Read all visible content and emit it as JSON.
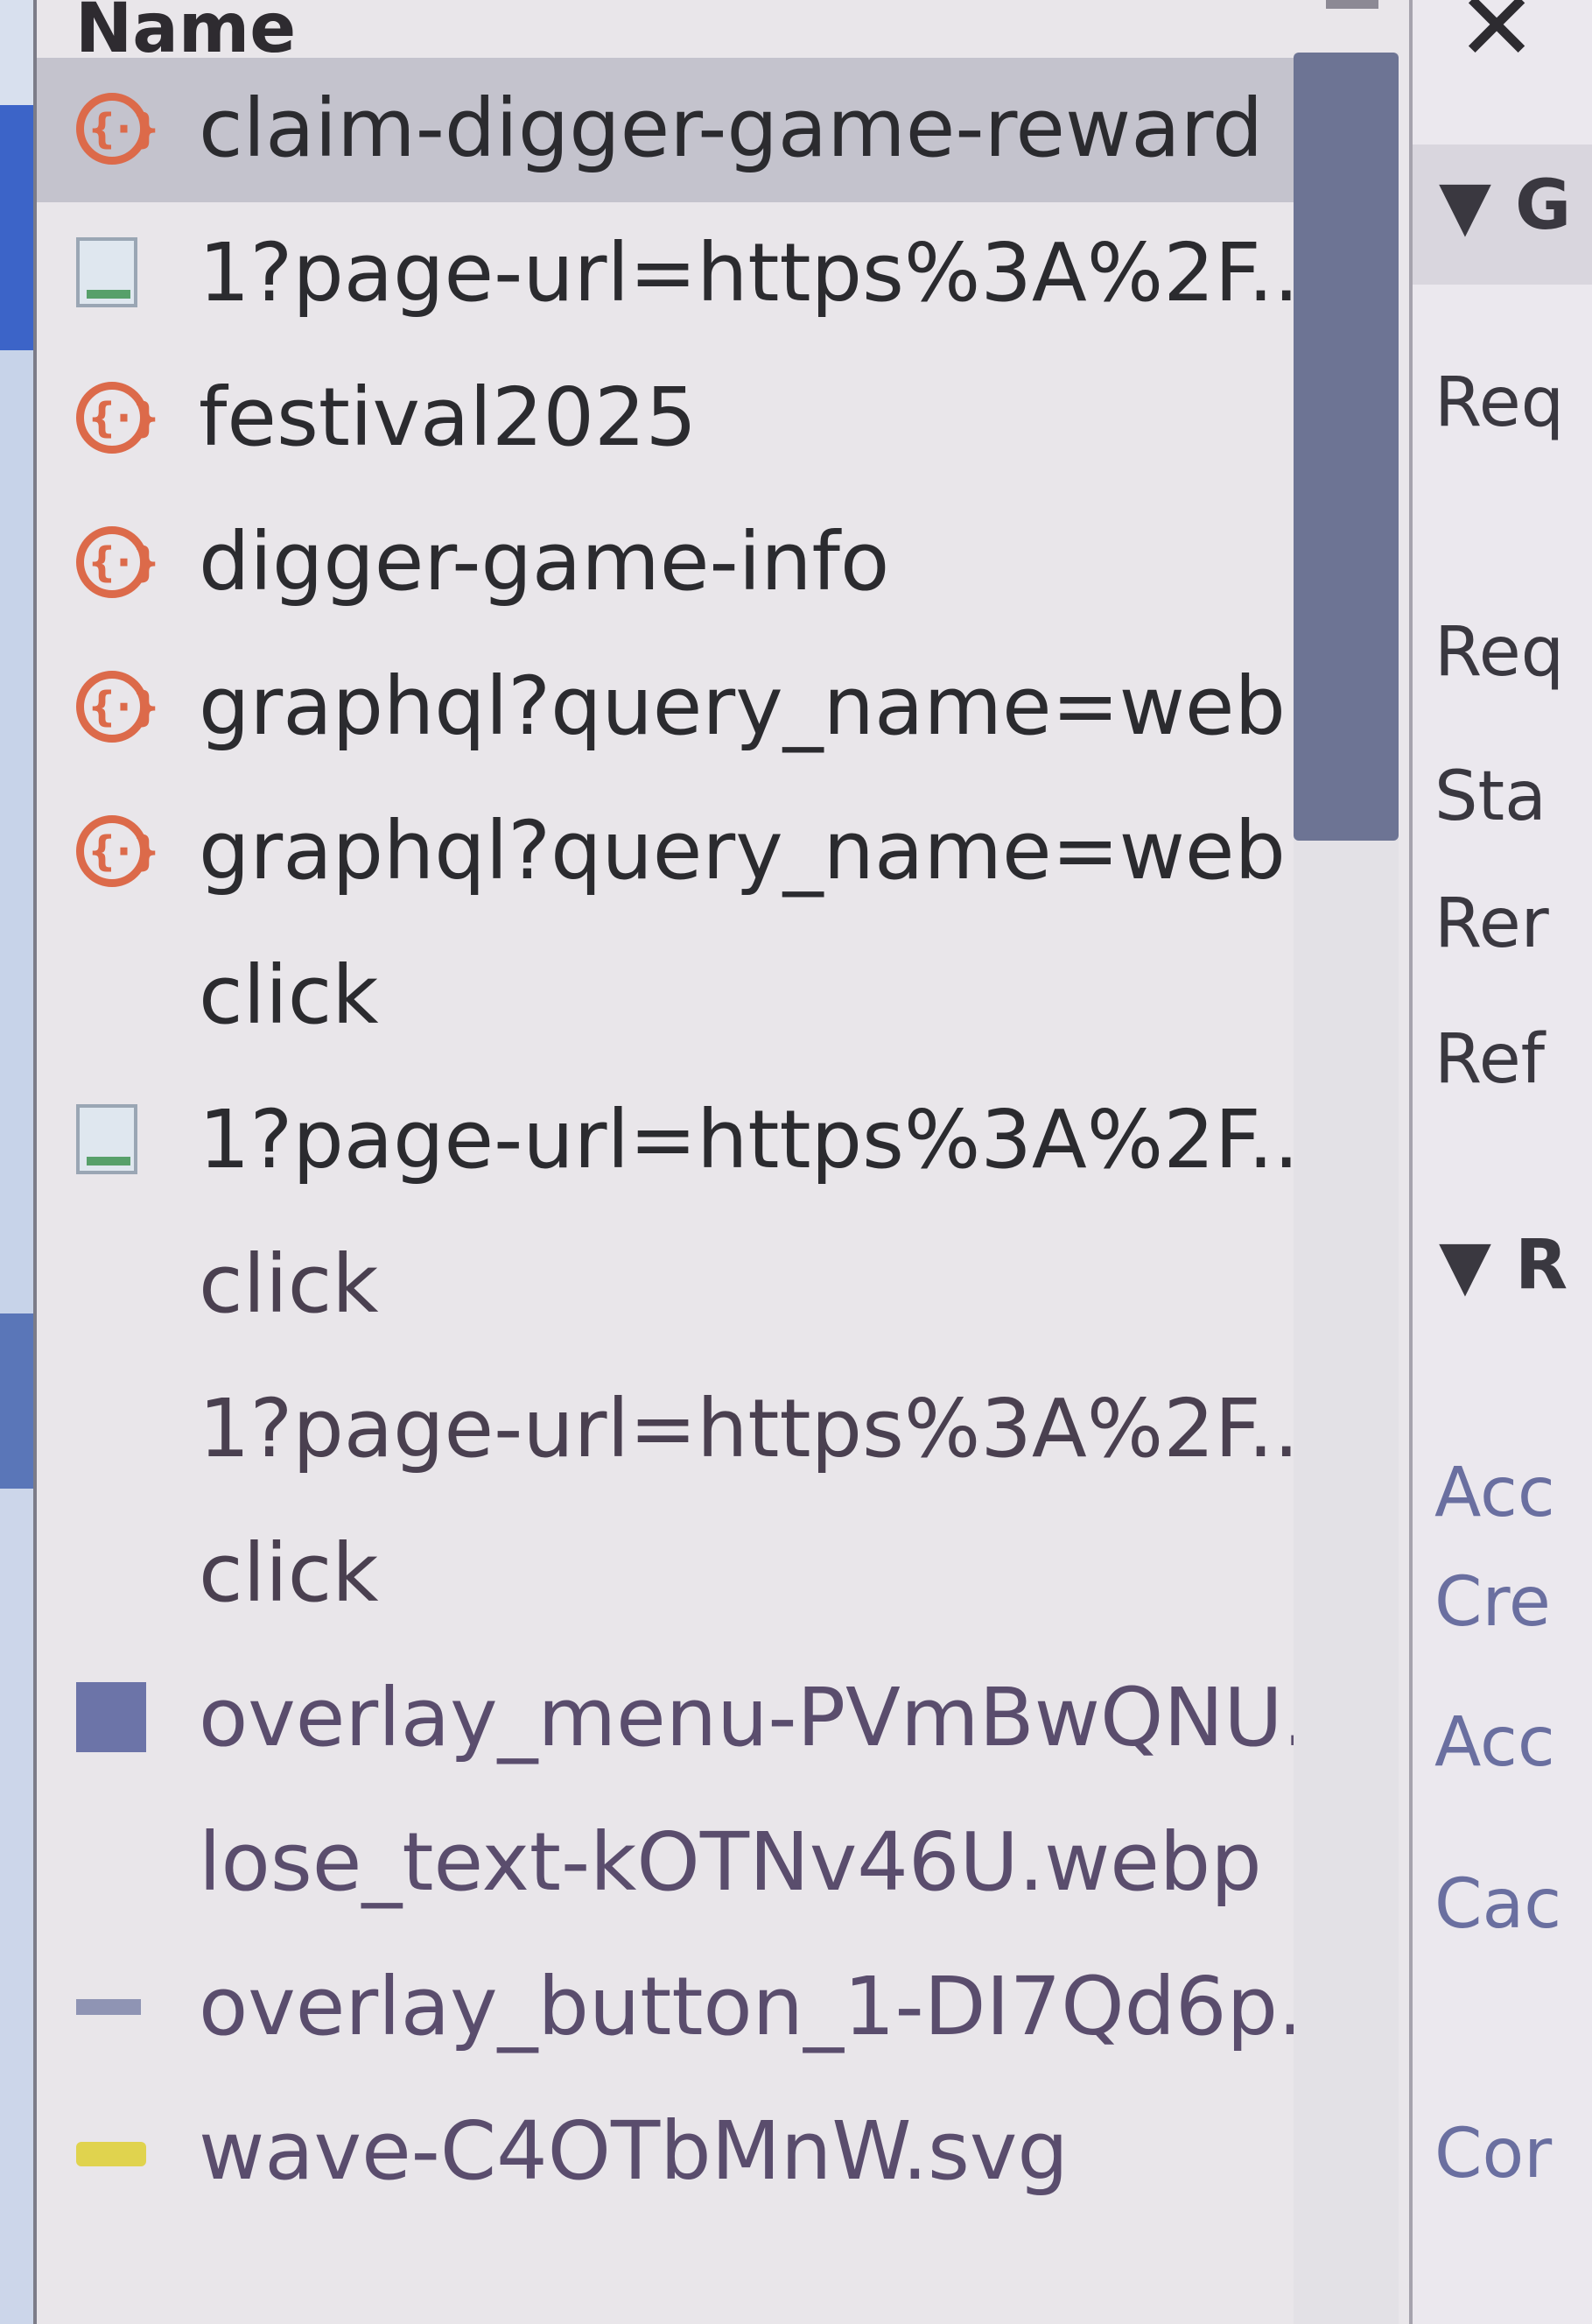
{
  "name_panel": {
    "header": "Name",
    "rows": [
      {
        "label": "claim-digger-game-reward",
        "icon": "fetch-icon"
      },
      {
        "label": "1?page-url=https%3A%2F...",
        "icon": "document-icon"
      },
      {
        "label": "festival2025",
        "icon": "fetch-icon"
      },
      {
        "label": "digger-game-info",
        "icon": "fetch-icon"
      },
      {
        "label": "graphql?query_name=web...",
        "icon": "fetch-icon"
      },
      {
        "label": "graphql?query_name=web...",
        "icon": "fetch-icon"
      },
      {
        "label": "click",
        "icon": "none"
      },
      {
        "label": "1?page-url=https%3A%2F...",
        "icon": "document-icon"
      },
      {
        "label": "click",
        "icon": "none"
      },
      {
        "label": "1?page-url=https%3A%2F...",
        "icon": "none"
      },
      {
        "label": "click",
        "icon": "none"
      },
      {
        "label": "overlay_menu-PVmBwQNU...",
        "icon": "image-icon"
      },
      {
        "label": "lose_text-kOTNv46U.webp",
        "icon": "none"
      },
      {
        "label": "overlay_button_1-DI7Qd6p...",
        "icon": "dash-icon"
      },
      {
        "label": "wave-C4OTbMnW.svg",
        "icon": "svg-icon"
      }
    ]
  },
  "details_panel": {
    "close_glyph": "✕",
    "general_section": "▼ G",
    "fields": [
      "Req",
      "Req",
      "Sta",
      "Rer",
      "Ref"
    ],
    "response_section": "▼ R",
    "fields2": [
      "Acc",
      "Cre",
      "Acc",
      "Cac",
      "Cor"
    ]
  },
  "colors": {
    "selected_row": "#c4c3cd",
    "fetch_icon": "#dc6a4a",
    "scrollbar_thumb": "#6d7494"
  }
}
